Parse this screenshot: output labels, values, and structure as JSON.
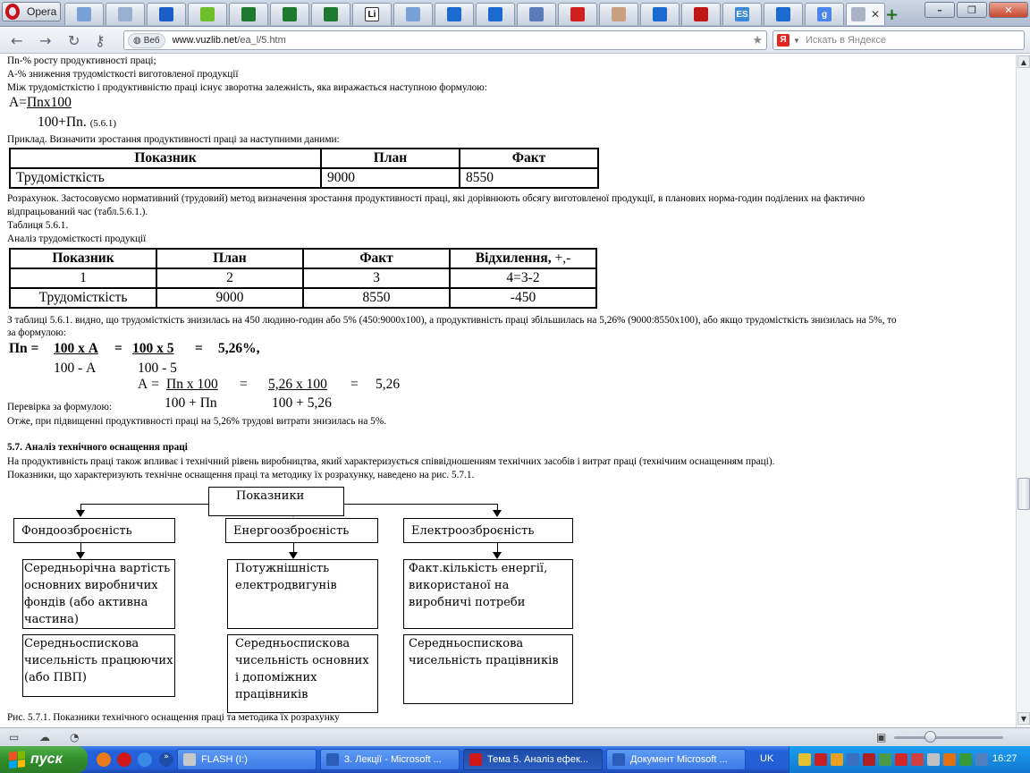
{
  "browser": {
    "menu_label": "Opera",
    "tabs": [
      {
        "icon": "page-icon",
        "color": "#7aa0d8"
      },
      {
        "icon": "page-icon",
        "color": "#9ab0d0"
      },
      {
        "icon": "info-icon",
        "color": "#1a5fc8"
      },
      {
        "icon": "apple-icon",
        "color": "#6fbf2a"
      },
      {
        "icon": "excel-icon",
        "color": "#1d7a2e"
      },
      {
        "icon": "excel-icon",
        "color": "#1d7a2e"
      },
      {
        "icon": "excel-icon",
        "color": "#1d7a2e"
      },
      {
        "icon": "li-icon",
        "color": "#222222"
      },
      {
        "icon": "page-icon",
        "color": "#7aa0d8"
      },
      {
        "icon": "upload-icon",
        "color": "#1a6ad0"
      },
      {
        "icon": "upload-icon",
        "color": "#1a6ad0"
      },
      {
        "icon": "document-icon",
        "color": "#5a7ab8"
      },
      {
        "icon": "bookmark-icon",
        "color": "#d02020"
      },
      {
        "icon": "chart-icon",
        "color": "#c8a080"
      },
      {
        "icon": "upload-icon",
        "color": "#1a6ad0"
      },
      {
        "icon": "pdf-icon",
        "color": "#c01818"
      },
      {
        "icon": "es-icon",
        "color": "#3a8ad8"
      },
      {
        "icon": "upload-icon",
        "color": "#1a6ad0"
      },
      {
        "icon": "google-icon",
        "color": "#4a86e8"
      },
      {
        "icon": "page-icon",
        "color": "#aab4c4",
        "active": true
      }
    ],
    "tab_fav_text": {
      "li": "Li",
      "es": "ES",
      "google": "g"
    },
    "newtab_label": "+",
    "web_badge": "Веб",
    "url_domain": "www.vuzlib.net",
    "url_path": "/ea_l/5.htm",
    "search_placeholder": "Искать в Яндексе",
    "search_engine_letter": "Я"
  },
  "doc": {
    "lines_top": [
      "Пn-% росту продуктивності праці;",
      "А-% зниження трудомісткості виготовленої продукції",
      "Між трудомісткістю і продуктивністю праці існує зворотна залежність, яка виражається наступною формулою:"
    ],
    "formula1_prefix": "А=",
    "formula1_num": "Пnх100",
    "formula1_den": "100+Пn.",
    "formula1_ref": "(5.6.1)",
    "example_line": "Приклад. Визначити зростання продуктивності праці за наступними даними:",
    "table1": {
      "headers": [
        "Показник",
        "План",
        "Факт"
      ],
      "row": [
        "Трудомісткість",
        "9000",
        "8550"
      ]
    },
    "calc_line_1": "Розрахунок. Застосовуємо нормативний (трудовий) метод визначення зростання продуктивності праці, які дорівнюють обсягу виготовленої продукції, в планових норма-годин поділених на фактично",
    "calc_line_2": "відпрацьований час (табл.5.6.1.).",
    "table_caption_1": "Таблиця 5.6.1.",
    "table_caption_2": "Аналіз трудомісткості продукції",
    "table2": {
      "headers": [
        "Показник",
        "План",
        "Факт",
        "Відхилення,"
      ],
      "header_suffix": "+,-",
      "num_row": [
        "1",
        "2",
        "3",
        "4=3-2"
      ],
      "row": [
        "Трудомісткість",
        "9000",
        "8550",
        "-450"
      ]
    },
    "result_line_1": "З таблиці 5.6.1. видно, що трудомісткість знизилась на 450 людино-годин або 5% (450:9000х100), а продуктивність праці збільшилась на 5,26% (9000:8550х100), або якщо трудомісткість знизилась на 5%, то",
    "result_line_2": "за формулою:",
    "f2": {
      "lhs": "Пn =",
      "num1": "100 х А",
      "eq1": "=",
      "num2": "100 х 5",
      "eq2": "=",
      "res": "5,26%,",
      "den1": "100 - А",
      "den2": "100 - 5"
    },
    "f3": {
      "lhs": "А =",
      "num1": "Пn х 100",
      "eq1": "=",
      "num2": "5,26 х 100",
      "eq2": "=",
      "res": "5,26",
      "den1": "100 + Пn",
      "den2": "100 + 5,26"
    },
    "check_line": "Перевірка за формулою:",
    "conclusion_line": "Отже, при підвищенні продуктивності праці на 5,26% трудові витрати знизилась на 5%.",
    "section_title": "5.7. Аналіз технічного оснащення праці",
    "section_p1": "На продуктивність праці також впливає і технічний рівень виробництва, який характеризується співвідношенням технічних засобів і витрат праці (технічним оснащенням праці).",
    "section_p2": "Показники, що характеризують технічне оснащення праці та методику їх розрахунку, наведено на рис. 5.7.1.",
    "diagram": {
      "root": "Показники",
      "columns": [
        {
          "title": "Фондоозброєність",
          "top": "Середньорічна вартість основних виробничих фондів (або активна частина)",
          "bottom": "Середньоспискова чисельність працюючих (або ПВП)"
        },
        {
          "title": "Енергоозброєність",
          "top": "Потужнішність електродвигунів",
          "bottom": "Середньоспискова чисельність основних і допоміжних працівників"
        },
        {
          "title": "Електроозброєність",
          "top": "Факт.кількість енергії, використаної на виробничі потреби",
          "bottom": "Середньоспискова чисельність працівників"
        }
      ]
    },
    "figure_caption": "Рис. 5.7.1. Показники технічного оснащення праці та методика їх розрахунку"
  },
  "taskbar": {
    "start_label": "пуск",
    "tasks": [
      {
        "label": "FLASH (I:)",
        "icon_color": "#c8c8c8",
        "active": false
      },
      {
        "label": "3. Лекції - Microsoft ...",
        "icon_color": "#2b5eb8",
        "active": false
      },
      {
        "label": "Тема 5. Аналіз ефек...",
        "icon_color": "#d01818",
        "active": true
      },
      {
        "label": "Документ Microsoft ...",
        "icon_color": "#2b5eb8",
        "active": false
      }
    ],
    "language": "UK",
    "clock": "16:27"
  }
}
